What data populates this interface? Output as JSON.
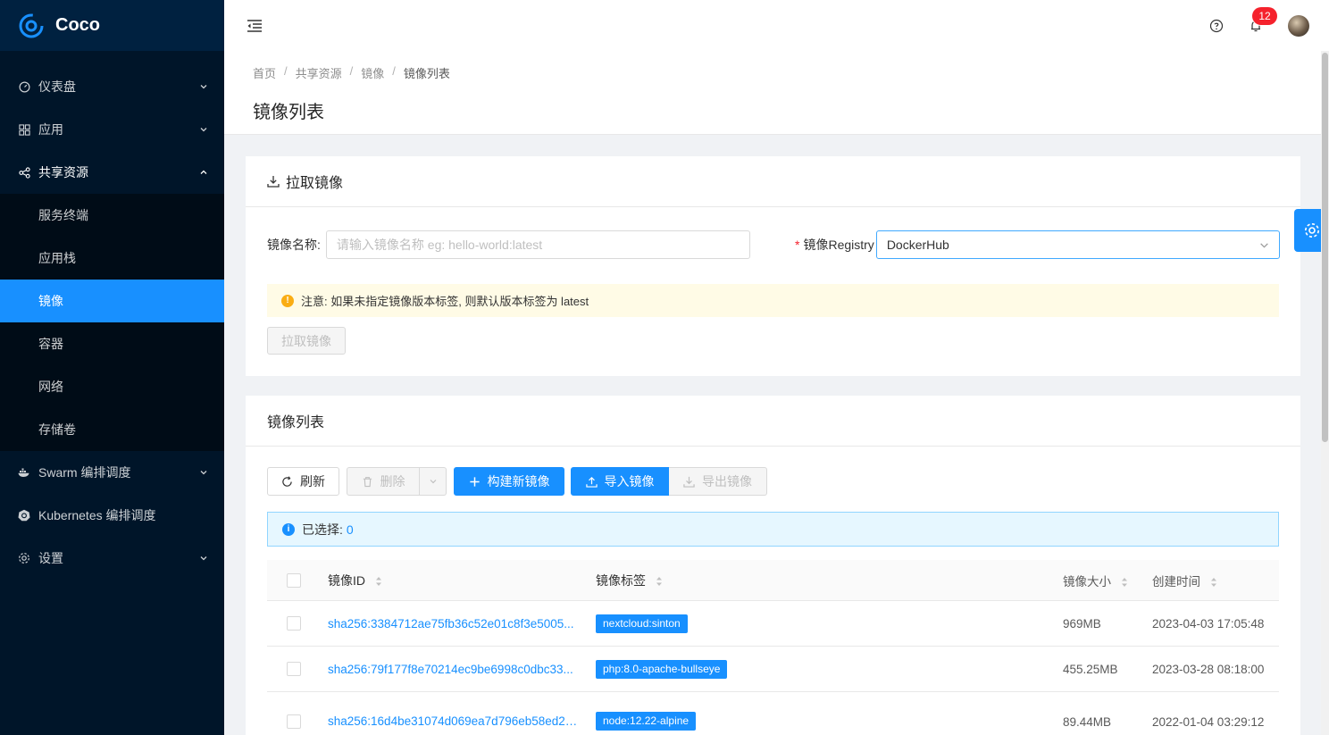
{
  "app": {
    "name": "Coco"
  },
  "sidebar": {
    "items": [
      {
        "label": "仪表盘",
        "icon": "dashboard-icon"
      },
      {
        "label": "应用",
        "icon": "appstore-icon"
      },
      {
        "label": "共享资源",
        "icon": "share-icon"
      },
      {
        "label": "Swarm 编排调度",
        "icon": "docker-icon"
      },
      {
        "label": "Kubernetes 编排调度",
        "icon": "kubernetes-icon"
      },
      {
        "label": "设置",
        "icon": "setting-icon"
      }
    ],
    "submenu": [
      {
        "label": "服务终端"
      },
      {
        "label": "应用栈"
      },
      {
        "label": "镜像"
      },
      {
        "label": "容器"
      },
      {
        "label": "网络"
      },
      {
        "label": "存储卷"
      }
    ]
  },
  "header": {
    "notification_count": "12"
  },
  "breadcrumb": {
    "items": [
      "首页",
      "共享资源",
      "镜像",
      "镜像列表"
    ]
  },
  "page": {
    "title": "镜像列表"
  },
  "pull_card": {
    "title": "拉取镜像",
    "name_label": "镜像名称:",
    "name_placeholder": "请输入镜像名称 eg: hello-world:latest",
    "registry_label": "镜像Registry",
    "registry_value": "DockerHub",
    "notice": "注意: 如果未指定镜像版本标签, 则默认版本标签为 latest",
    "pull_button": "拉取镜像"
  },
  "list_card": {
    "title": "镜像列表",
    "toolbar": {
      "refresh": "刷新",
      "delete": "删除",
      "build": "构建新镜像",
      "import": "导入镜像",
      "export": "导出镜像"
    },
    "selected_label": "已选择: ",
    "selected_count": "0",
    "columns": [
      "镜像ID",
      "镜像标签",
      "镜像大小",
      "创建时间"
    ],
    "rows": [
      {
        "id": "sha256:3384712ae75fb36c52e01c8f3e5005...",
        "tag": "nextcloud:sinton",
        "size": "969MB",
        "created": "2023-04-03 17:05:48"
      },
      {
        "id": "sha256:79f177f8e70214ec9be6998c0dbc33...",
        "tag": "php:8.0-apache-bullseye",
        "size": "455.25MB",
        "created": "2023-03-28 08:18:00"
      },
      {
        "id": "sha256:16d4be31074d069ea7d796eb58ed2a...",
        "tag": "node:12.22-alpine",
        "size": "89.44MB",
        "created": "2022-01-04 03:29:12"
      }
    ]
  },
  "colors": {
    "primary": "#1890ff",
    "sidebar": "#001529",
    "submenu": "#000c17",
    "warning": "#faad14"
  }
}
